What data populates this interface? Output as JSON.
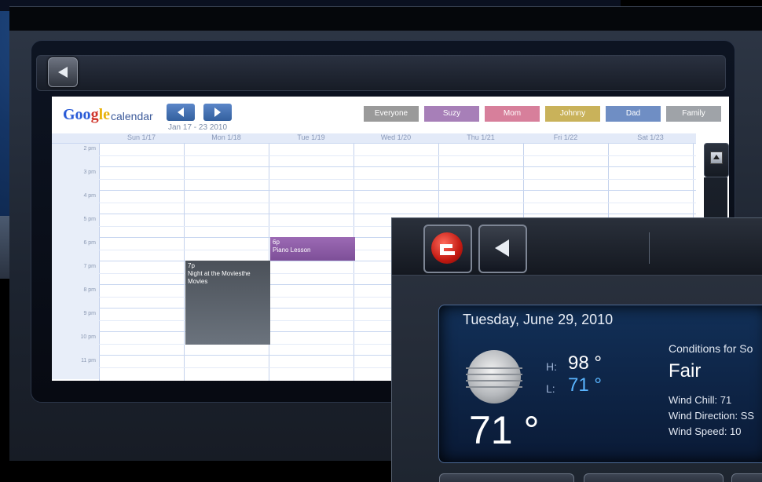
{
  "calendar": {
    "logo": {
      "part1": "Goo",
      "part2": "g",
      "part3": "le",
      "word": "calendar"
    },
    "date_range": "Jan 17 - 23 2010",
    "filters": [
      {
        "label": "Everyone",
        "color": "#9a9a9a"
      },
      {
        "label": "Suzy",
        "color": "#a77fb8"
      },
      {
        "label": "Mom",
        "color": "#d77f9b"
      },
      {
        "label": "Johnny",
        "color": "#c9b25a"
      },
      {
        "label": "Dad",
        "color": "#6f8ec4"
      },
      {
        "label": "Family",
        "color": "#9fa3a8"
      }
    ],
    "days": [
      "Sun 1/17",
      "Mon 1/18",
      "Tue 1/19",
      "Wed 1/20",
      "Thu 1/21",
      "Fri 1/22",
      "Sat 1/23"
    ],
    "hours": [
      "2 pm",
      "3 pm",
      "4 pm",
      "5 pm",
      "6 pm",
      "7 pm",
      "8 pm",
      "9 pm",
      "10 pm",
      "11 pm"
    ],
    "events": [
      {
        "time": "6p",
        "title": "Piano Lesson",
        "color": "#8c5aa6"
      },
      {
        "time": "7p",
        "title": "Night at the Moviesthe Movies",
        "color": "#5a616b"
      }
    ]
  },
  "weather": {
    "date": "Tuesday, June 29, 2010",
    "high_label": "H:",
    "high": "98 °",
    "low_label": "L:",
    "low": "71 °",
    "current": "71 °",
    "conditions_title": "Conditions for So",
    "condition": "Fair",
    "wind_chill": "Wind Chill: 71",
    "wind_direction": "Wind Direction: SS",
    "wind_speed": "Wind Speed: 10",
    "icon": "moon-icon"
  }
}
